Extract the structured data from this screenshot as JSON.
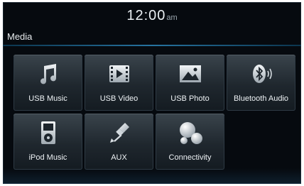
{
  "clock": {
    "time": "12:00",
    "ampm": "am"
  },
  "header": {
    "title": "Media"
  },
  "tiles": [
    {
      "label": "USB Music",
      "icon": "music-note-icon"
    },
    {
      "label": "USB Video",
      "icon": "video-icon"
    },
    {
      "label": "USB Photo",
      "icon": "photo-icon"
    },
    {
      "label": "Bluetooth Audio",
      "icon": "bluetooth-audio-icon"
    },
    {
      "label": "iPod Music",
      "icon": "ipod-icon"
    },
    {
      "label": "AUX",
      "icon": "aux-cable-icon"
    },
    {
      "label": "Connectivity",
      "icon": "connectivity-icon"
    }
  ],
  "colors": {
    "background": "#060a0f",
    "accent_rule": "#2a7fb0",
    "tile_top": "#3a444c",
    "icon": "#d7dde2"
  }
}
